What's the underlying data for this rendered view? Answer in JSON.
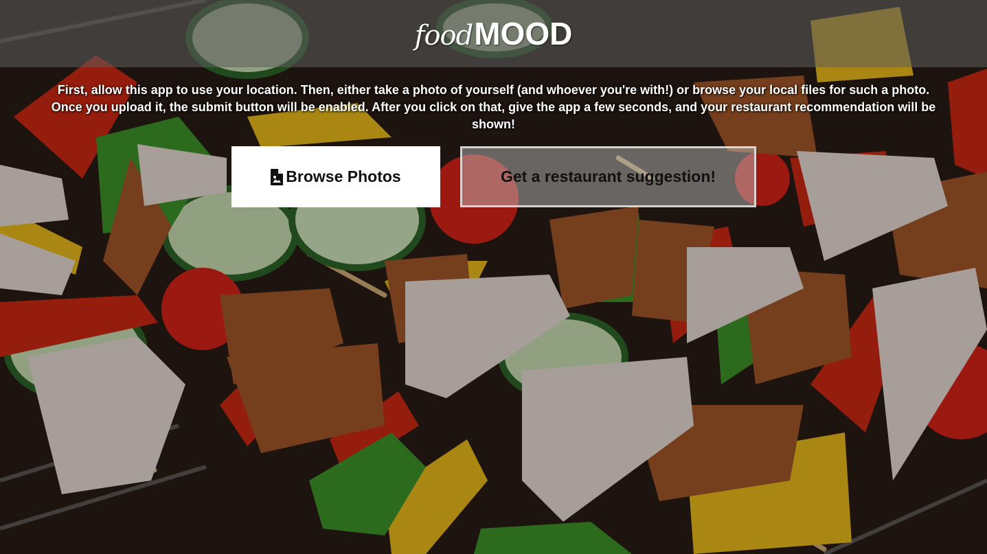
{
  "header": {
    "logo_script": "food",
    "logo_bold": "MOOD"
  },
  "instructions": "First, allow this app to use your location. Then, either take a photo of yourself (and whoever you're with!) or browse your local files for such a photo. Once you upload it, the submit button will be enabled. After you click on that, give the app a few seconds, and your restaurant recommendation will be shown!",
  "buttons": {
    "browse": {
      "icon": "file-image-icon",
      "label": "Browse Photos"
    },
    "submit": {
      "label": "Get a restaurant suggestion!",
      "enabled": false
    }
  },
  "background": {
    "image": "grilled-vegetable-and-meat-skewers"
  },
  "colors": {
    "header_overlay": "#5f5f5f",
    "button_primary_bg": "#ffffff",
    "button_disabled_bg": "#c8c8c8",
    "text_light": "#ffffff",
    "text_dark": "#111111"
  }
}
